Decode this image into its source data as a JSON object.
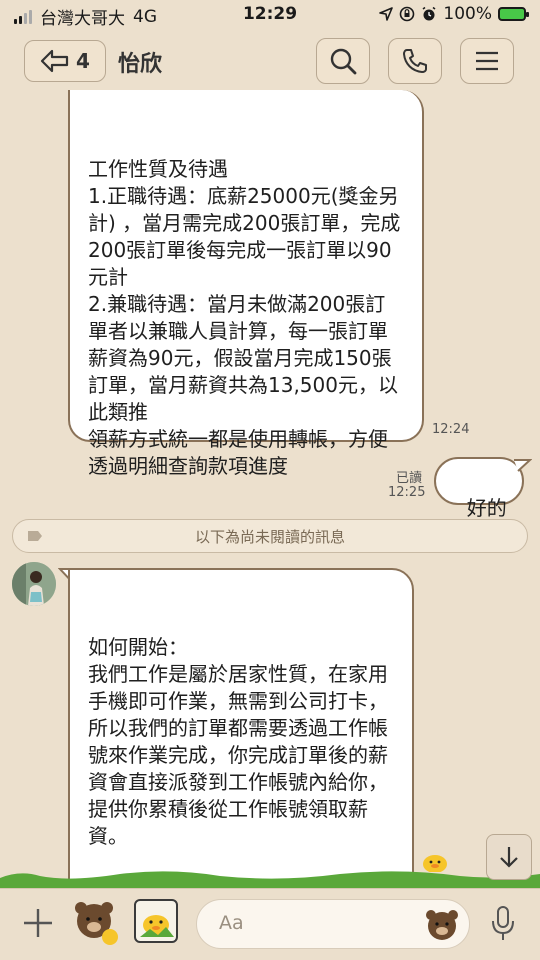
{
  "status_bar": {
    "carrier": "台灣大哥大",
    "network": "4G",
    "time": "12:29",
    "battery": "100%"
  },
  "header": {
    "back_count": "4",
    "chat_name": "怡欣"
  },
  "messages": [
    {
      "from": "other",
      "text": "工作性質及待遇\n1.正職待遇：底薪25000元(獎金另計) ，當月需完成200張訂單，完成200張訂單後每完成一張訂單以90元計\n2.兼職待遇：當月未做滿200張訂單者以兼職人員計算，每一張訂單薪資為90元，假設當月完成150張訂單，當月薪資共為13,500元，以此類推\n領薪方式統一都是使用轉帳，方便透過明細查詢款項進度",
      "time": "12:24"
    },
    {
      "from": "me",
      "text": "好的",
      "read_label": "已讀",
      "time": "12:25"
    },
    {
      "from": "other",
      "text": "如何開始：\n我們工作是屬於居家性質，在家用手機即可作業，無需到公司打卡，所以我們的訂單都需要透過工作帳號來作業完成，你完成訂單後的薪資會直接派發到工作帳號內給你，提供你累積後從工作帳號領取薪資。\n\n那為了方便統計薪資以及節省轉帳後銀行所收取的手續費，"
    }
  ],
  "unread_divider": "以下為尚未閱讀的訊息",
  "composer": {
    "placeholder": "Aa"
  },
  "colors": {
    "background": "#ece0cd",
    "bubble_border": "#8a7258",
    "battery": "#48c848"
  }
}
